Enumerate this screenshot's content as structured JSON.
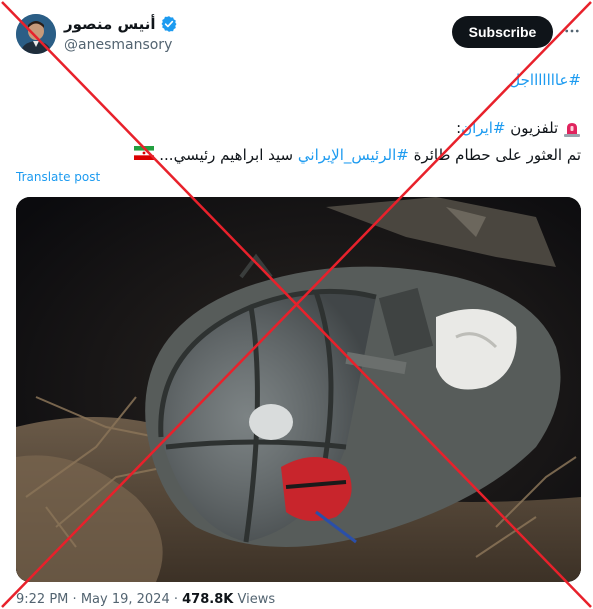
{
  "author": {
    "display_name": "أنيس منصور",
    "handle": "@anesmansory",
    "verified": true
  },
  "header": {
    "subscribe_label": "Subscribe",
    "more_icon": "more-horizontal-icon"
  },
  "tweet": {
    "line1_hashtag": "#عاااااااجل",
    "line2_prefix": "تلفزيون ",
    "line2_hashtag": "#ايران",
    "line2_suffix": ":",
    "line3_part1": "تم العثور على حطام طائرة ",
    "line3_hashtag": "#الرئيس_الإيراني",
    "line3_part2": " سيد ابراهيم رئيسي...",
    "emoji_siren": "siren-emoji",
    "emoji_flag": "iran-flag-emoji"
  },
  "translate_label": "Translate post",
  "footer": {
    "time": "9:22 PM",
    "date": "May 19, 2024",
    "views_count": "478.8K",
    "views_label": "Views",
    "separator": "·"
  },
  "overlay": {
    "mark": "red-x-cross",
    "color": "#e8212b"
  }
}
